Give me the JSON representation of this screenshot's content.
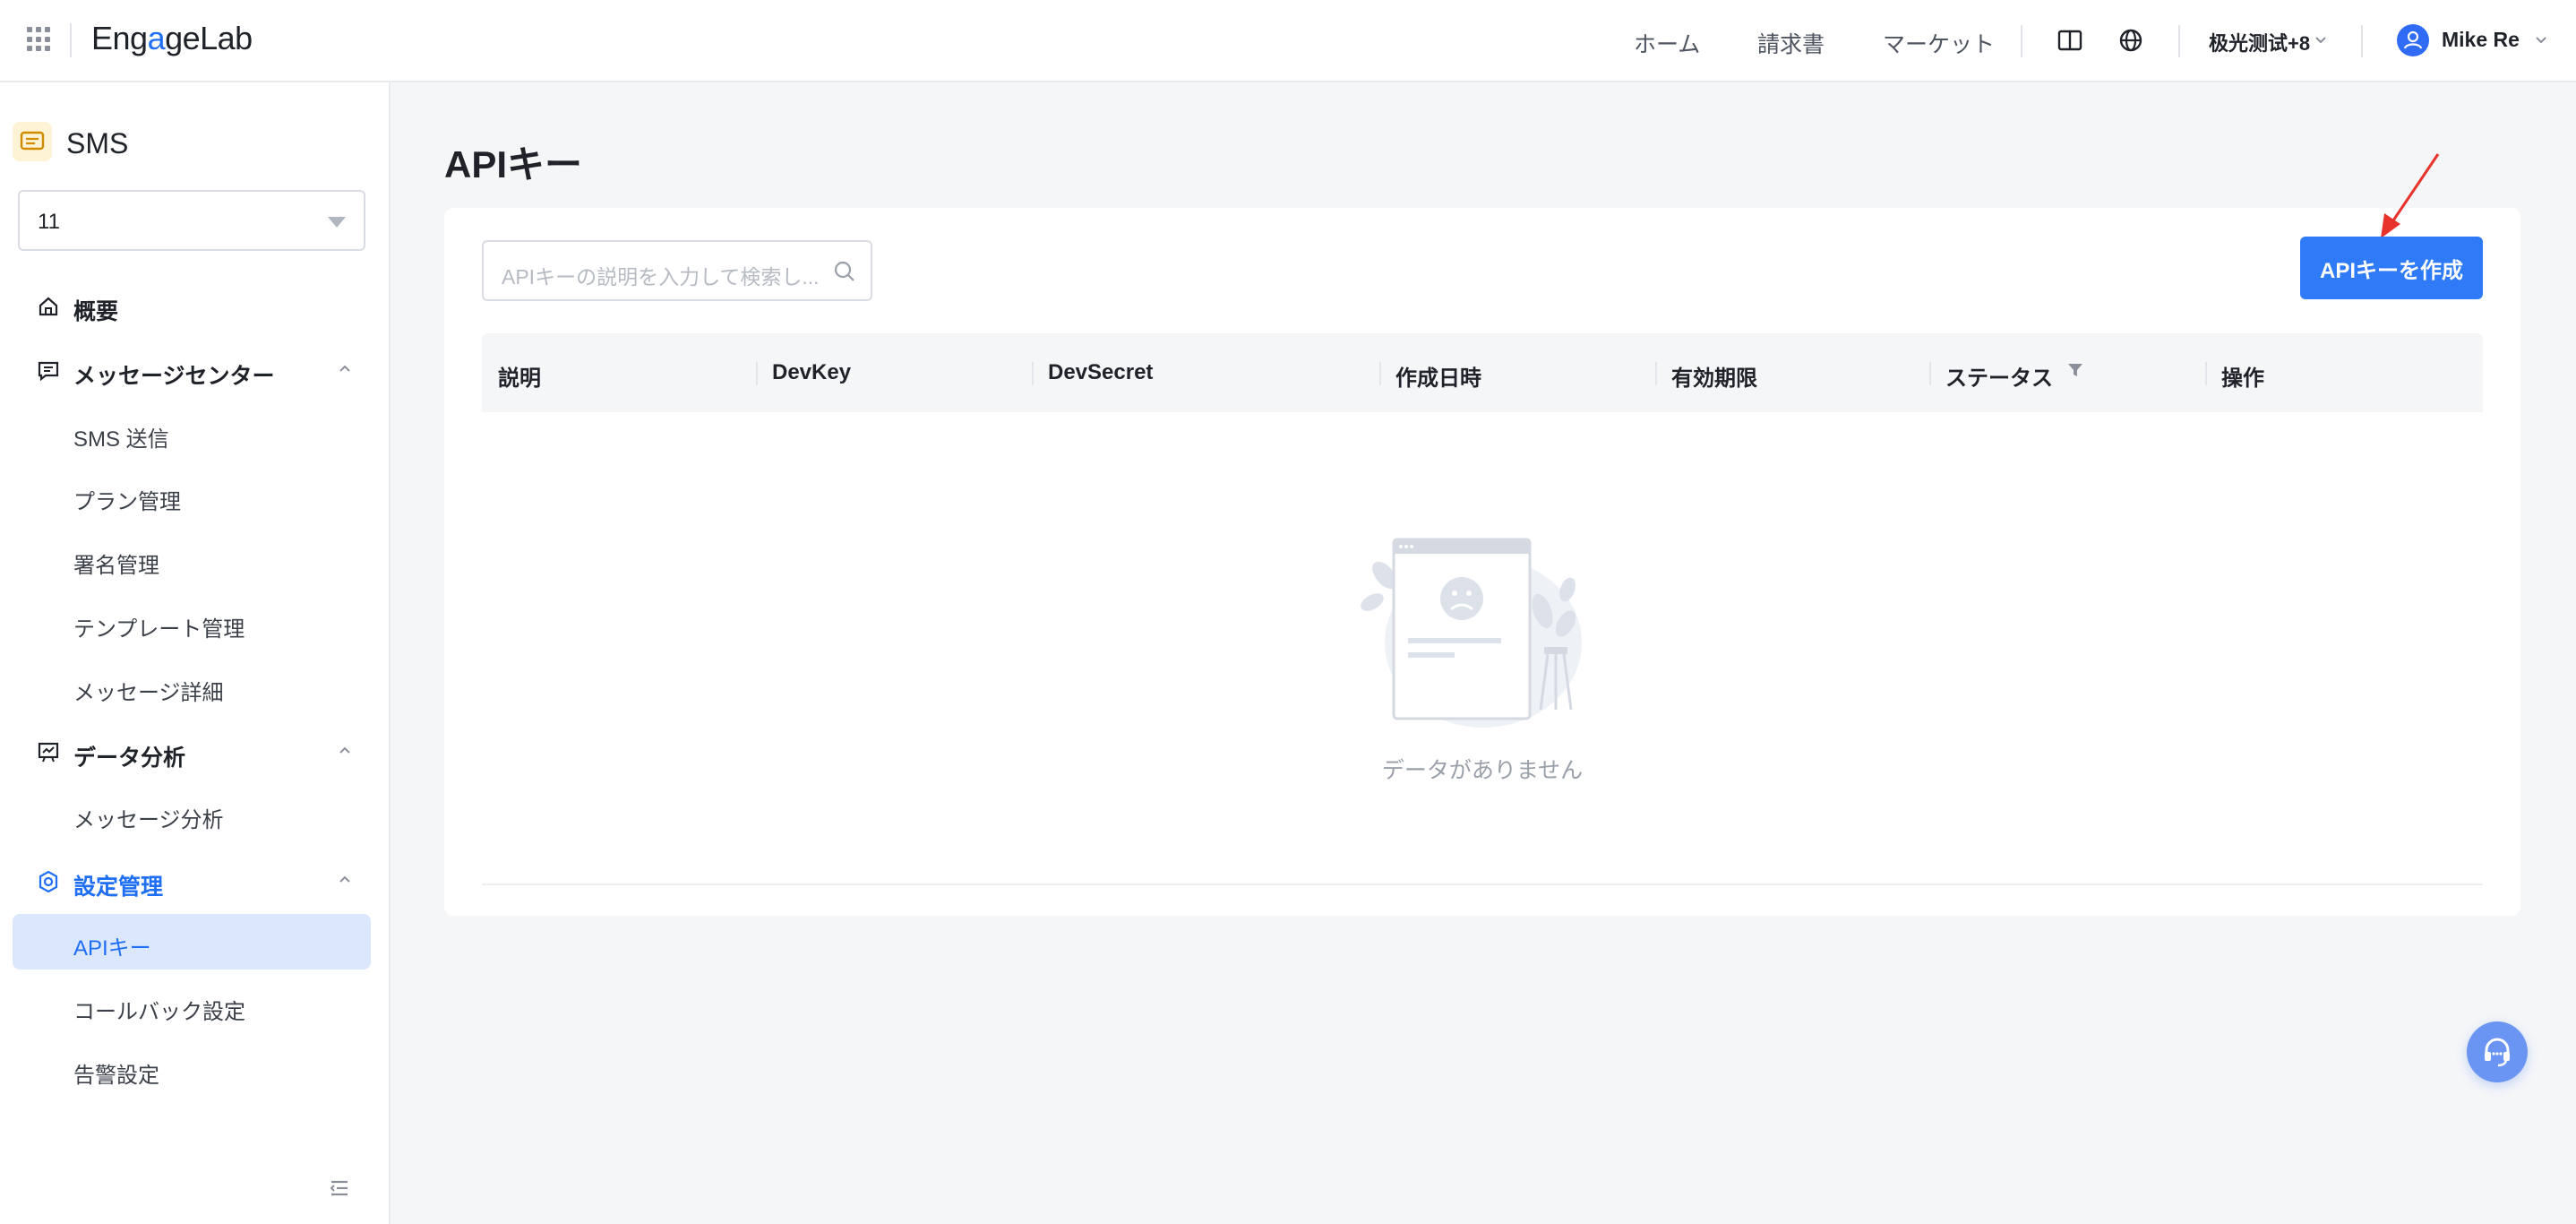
{
  "header": {
    "logo_prefix": "Eng",
    "logo_accent": "a",
    "logo_suffix": "geLab",
    "nav": [
      "ホーム",
      "請求書",
      "マーケット"
    ],
    "timezone": "极光测试+8",
    "user_name": "Mike Re"
  },
  "sidebar": {
    "product": "SMS",
    "app_select_value": "11",
    "groups": [
      {
        "label": "概要"
      },
      {
        "label": "メッセージセンター",
        "items": [
          "SMS 送信",
          "プラン管理",
          "署名管理",
          "テンプレート管理",
          "メッセージ詳細"
        ]
      },
      {
        "label": "データ分析",
        "items": [
          "メッセージ分析"
        ]
      },
      {
        "label": "設定管理",
        "items": [
          "APIキー",
          "コールバック設定",
          "告警設定"
        ]
      }
    ],
    "active_item": "APIキー"
  },
  "main": {
    "title": "APIキー",
    "search_placeholder": "APIキーの説明を入力して検索し...",
    "create_button": "APIキーを作成",
    "columns": [
      "説明",
      "DevKey",
      "DevSecret",
      "作成日時",
      "有効期限",
      "ステータス",
      "操作"
    ],
    "empty_text": "データがありません"
  },
  "colors": {
    "accent": "#2f7bf7",
    "active_bg": "#dbe7fd",
    "annotation_arrow": "#e8322c"
  },
  "icons": [
    "apps-grid-icon",
    "book-icon",
    "globe-icon",
    "chevron-down-icon",
    "user-icon",
    "sms-icon",
    "home-icon",
    "message-icon",
    "chart-icon",
    "settings-icon",
    "chevron-up-icon",
    "collapse-icon",
    "search-icon",
    "filter-icon",
    "headset-icon"
  ]
}
